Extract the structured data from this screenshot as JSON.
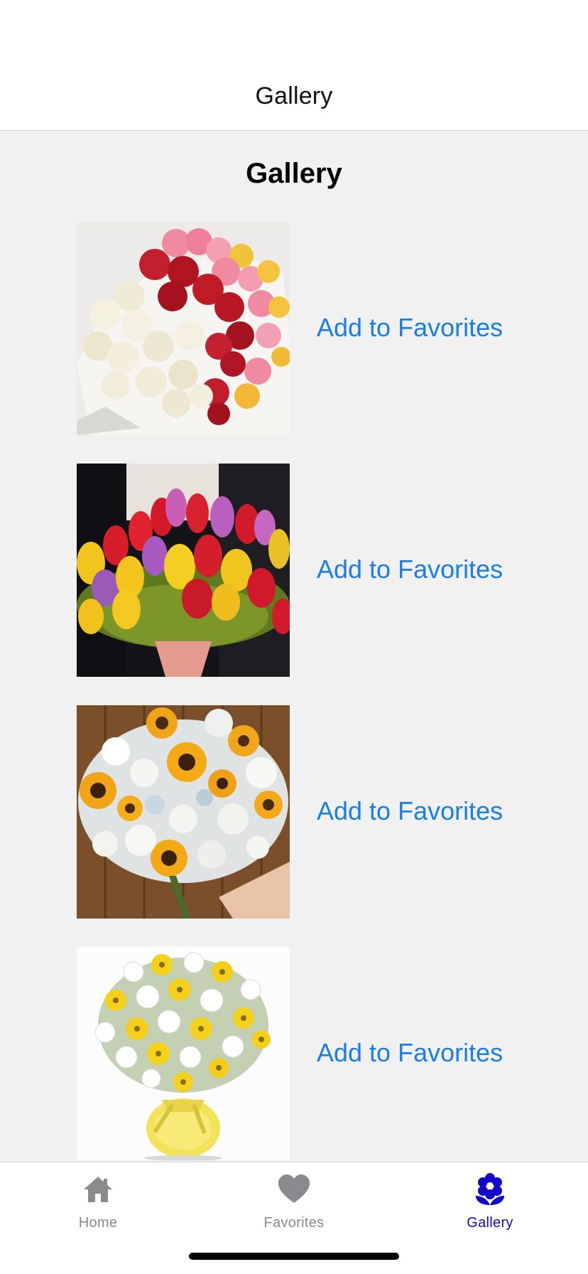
{
  "navbar": {
    "title": "Gallery"
  },
  "page": {
    "title": "Gallery"
  },
  "gallery": [
    {
      "image": "mixed-roses-bouquet",
      "action_label": "Add to Favorites"
    },
    {
      "image": "tulip-bouquet",
      "action_label": "Add to Favorites"
    },
    {
      "image": "sunflower-rose-bouquet",
      "action_label": "Add to Favorites"
    },
    {
      "image": "daisy-vase-bouquet",
      "action_label": "Add to Favorites"
    }
  ],
  "tabbar": {
    "items": [
      {
        "label": "Home",
        "icon": "house-icon",
        "active": false
      },
      {
        "label": "Favorites",
        "icon": "heart-icon",
        "active": false
      },
      {
        "label": "Gallery",
        "icon": "flower-icon",
        "active": true
      }
    ]
  },
  "colors": {
    "link": "#1a7ee6",
    "active_tab": "#1307c9",
    "inactive_tab": "#8a8a8e",
    "background": "#f1f1f2"
  }
}
